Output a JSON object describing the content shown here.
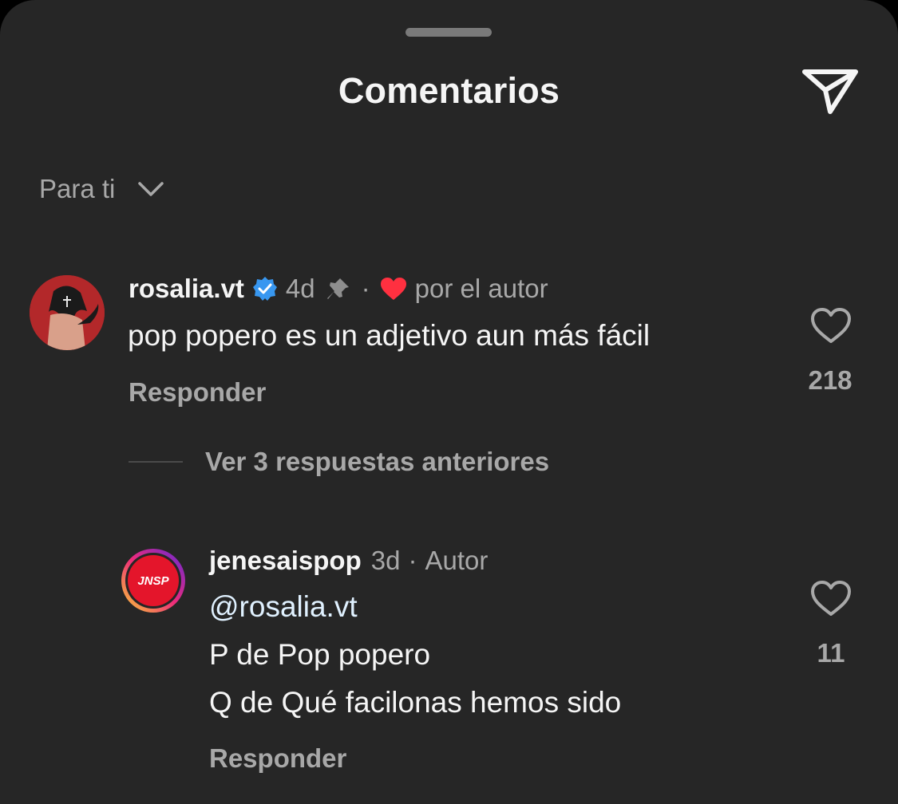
{
  "header": {
    "title": "Comentarios",
    "share_icon": "send-icon"
  },
  "sort": {
    "label": "Para ti",
    "icon": "chevron-down-icon"
  },
  "comments": [
    {
      "username": "rosalia.vt",
      "verified": true,
      "time": "4d",
      "pinned": true,
      "separator": "·",
      "liked_by_author_label": "por el autor",
      "text": "pop popero es un adjetivo aun más fácil",
      "reply_label": "Responder",
      "like_count": "218"
    }
  ],
  "view_replies_label": "Ver 3 respuestas anteriores",
  "replies": [
    {
      "username": "jenesaispop",
      "time": "3d",
      "separator": "·",
      "role_label": "Autor",
      "avatar_text": "JNSP",
      "mention": "@rosalia.vt",
      "lines": [
        "P de Pop popero",
        "Q de Qué facilonas hemos sido"
      ],
      "reply_label": "Responder",
      "like_count": "11"
    }
  ],
  "colors": {
    "background": "#262626",
    "secondary_text": "#a8a8a8",
    "verified": "#3897f0",
    "heart": "#ff3040"
  }
}
